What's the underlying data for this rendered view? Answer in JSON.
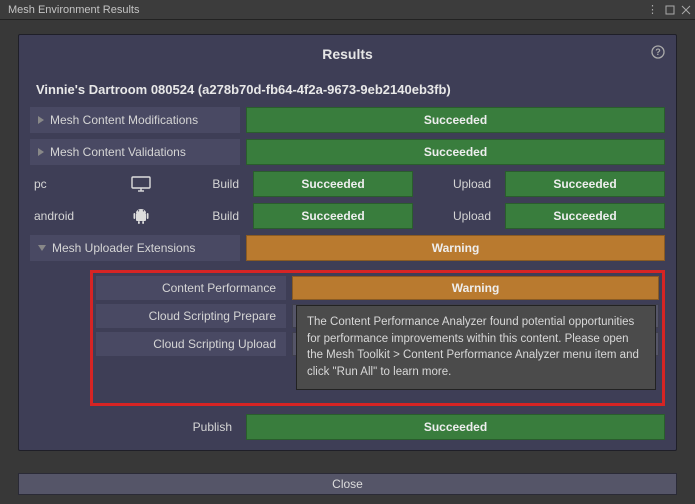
{
  "window": {
    "title": "Mesh Environment Results"
  },
  "header": {
    "title": "Results"
  },
  "environment": {
    "title": "Vinnie's Dartroom 080524 (a278b70d-fb64-4f2a-9673-9eb2140eb3fb)"
  },
  "sections": {
    "modifications": {
      "label": "Mesh Content Modifications",
      "status": "Succeeded"
    },
    "validations": {
      "label": "Mesh Content Validations",
      "status": "Succeeded"
    }
  },
  "platforms": [
    {
      "name": "pc",
      "build_label": "Build",
      "build_status": "Succeeded",
      "upload_label": "Upload",
      "upload_status": "Succeeded"
    },
    {
      "name": "android",
      "build_label": "Build",
      "build_status": "Succeeded",
      "upload_label": "Upload",
      "upload_status": "Succeeded"
    }
  ],
  "uploader_ext": {
    "label": "Mesh Uploader Extensions",
    "status": "Warning"
  },
  "callout": {
    "content_perf": {
      "label": "Content Performance",
      "status": "Warning"
    },
    "script_prepare": {
      "label": "Cloud Scripting Prepare"
    },
    "script_upload": {
      "label": "Cloud Scripting Upload"
    },
    "tooltip": "The Content Performance Analyzer found potential opportunities for performance improvements within this content. Please open the Mesh Toolkit > Content Performance Analyzer menu item and click \"Run All\" to learn more."
  },
  "publish": {
    "label": "Publish",
    "status": "Succeeded"
  },
  "footer": {
    "close_label": "Close"
  },
  "colors": {
    "succeeded": "#397d3d",
    "warning": "#b97a2f",
    "callout_border": "#d62424"
  }
}
